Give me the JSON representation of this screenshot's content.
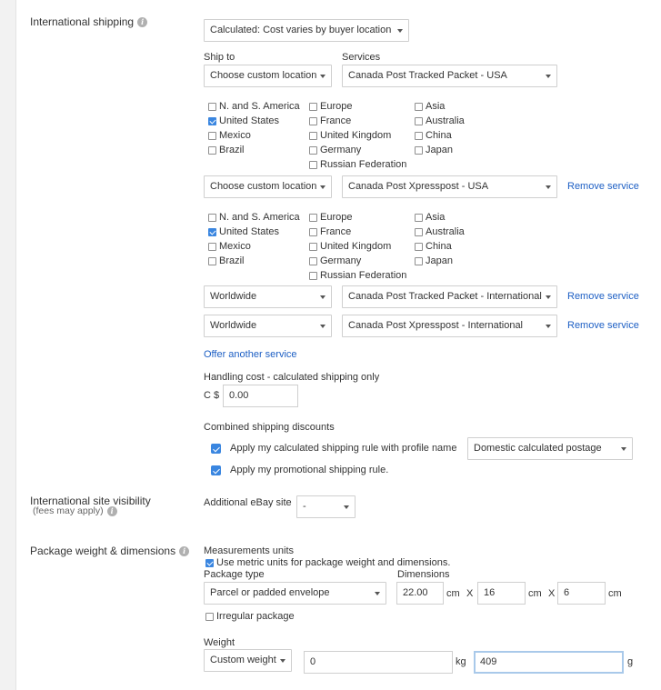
{
  "international_shipping": {
    "label": "International shipping",
    "info_icon": "info-icon",
    "cost_type": "Calculated: Cost varies by buyer location",
    "ship_to_header": "Ship to",
    "services_header": "Services",
    "services": [
      {
        "ship_to": "Choose custom location",
        "service": "Canada Post Tracked Packet - USA",
        "remove_label": "",
        "locations": {
          "col1": [
            {
              "label": "N. and S. America",
              "checked": false
            },
            {
              "label": "United States",
              "checked": true
            },
            {
              "label": "Mexico",
              "checked": false
            },
            {
              "label": "Brazil",
              "checked": false
            }
          ],
          "col2": [
            {
              "label": "Europe",
              "checked": false
            },
            {
              "label": "France",
              "checked": false
            },
            {
              "label": "United Kingdom",
              "checked": false
            },
            {
              "label": "Germany",
              "checked": false
            },
            {
              "label": "Russian Federation",
              "checked": false
            }
          ],
          "col3": [
            {
              "label": "Asia",
              "checked": false
            },
            {
              "label": "Australia",
              "checked": false
            },
            {
              "label": "China",
              "checked": false
            },
            {
              "label": "Japan",
              "checked": false
            }
          ]
        }
      },
      {
        "ship_to": "Choose custom location",
        "service": "Canada Post Xpresspost - USA",
        "remove_label": "Remove service",
        "locations": {
          "col1": [
            {
              "label": "N. and S. America",
              "checked": false
            },
            {
              "label": "United States",
              "checked": true
            },
            {
              "label": "Mexico",
              "checked": false
            },
            {
              "label": "Brazil",
              "checked": false
            }
          ],
          "col2": [
            {
              "label": "Europe",
              "checked": false
            },
            {
              "label": "France",
              "checked": false
            },
            {
              "label": "United Kingdom",
              "checked": false
            },
            {
              "label": "Germany",
              "checked": false
            },
            {
              "label": "Russian Federation",
              "checked": false
            }
          ],
          "col3": [
            {
              "label": "Asia",
              "checked": false
            },
            {
              "label": "Australia",
              "checked": false
            },
            {
              "label": "China",
              "checked": false
            },
            {
              "label": "Japan",
              "checked": false
            }
          ]
        }
      },
      {
        "ship_to": "Worldwide",
        "service": "Canada Post Tracked Packet - International",
        "remove_label": "Remove service"
      },
      {
        "ship_to": "Worldwide",
        "service": "Canada Post Xpresspost - International",
        "remove_label": "Remove service"
      }
    ],
    "offer_another": "Offer another service",
    "handling": {
      "label": "Handling cost - calculated shipping only",
      "currency": "C $",
      "value": "0.00"
    },
    "combined": {
      "label": "Combined shipping discounts",
      "rule1_label": "Apply my calculated shipping rule with profile name",
      "rule1_checked": true,
      "profile": "Domestic calculated postage",
      "rule2_label": "Apply my promotional shipping rule.",
      "rule2_checked": true
    }
  },
  "site_visibility": {
    "label": "International site visibility",
    "sublabel": "(fees may apply)",
    "info_icon": "info-icon",
    "additional_label": "Additional eBay site",
    "additional_value": "-"
  },
  "package": {
    "label": "Package weight & dimensions",
    "info_icon": "info-icon",
    "measurements_label": "Measurements units",
    "metric_label": "Use metric units for package weight and dimensions.",
    "metric_checked": true,
    "type_label": "Package type",
    "type_value": "Parcel or padded envelope",
    "dimensions_label": "Dimensions",
    "dim1": "22.00",
    "dim2": "16",
    "dim3": "6",
    "dim_unit": "cm",
    "dim_sep": "X",
    "irregular_label": "Irregular package",
    "irregular_checked": false,
    "weight_label": "Weight",
    "weight_type": "Custom weight",
    "weight_kg": "0",
    "kg_unit": "kg",
    "weight_g": "409",
    "g_unit": "g"
  },
  "colors": {
    "link": "#1d5fc4",
    "checkbox_checked": "#3a86e0",
    "focus_border": "#a9c9ea"
  }
}
